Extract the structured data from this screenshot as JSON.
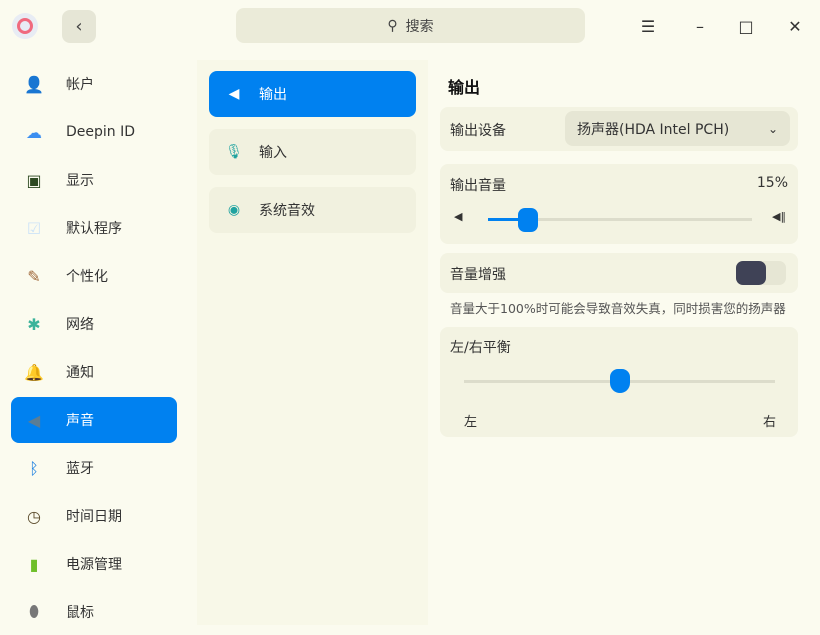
{
  "titlebar": {
    "back_icon": "chevron-left",
    "search_placeholder": "搜索",
    "menu_icon": "☰",
    "min_icon": "–",
    "max_icon": "□",
    "close_icon": "✕"
  },
  "sidebar": {
    "items": [
      {
        "label": "帐户",
        "icon": "user-icon",
        "color": "#222"
      },
      {
        "label": "Deepin ID",
        "icon": "cloud-icon",
        "color": "#3b8ef0"
      },
      {
        "label": "显示",
        "icon": "monitor-icon",
        "color": "#2e4a22"
      },
      {
        "label": "默认程序",
        "icon": "default-apps-icon",
        "color": "#cde3f7"
      },
      {
        "label": "个性化",
        "icon": "palette-icon",
        "color": "#a0683a"
      },
      {
        "label": "网络",
        "icon": "network-icon",
        "color": "#3bb39a"
      },
      {
        "label": "通知",
        "icon": "bell-icon",
        "color": "#8b8a6a"
      },
      {
        "label": "声音",
        "icon": "speaker-icon",
        "color": "#5a7d95"
      },
      {
        "label": "蓝牙",
        "icon": "bluetooth-icon",
        "color": "#1a7fe0"
      },
      {
        "label": "时间日期",
        "icon": "clock-icon",
        "color": "#5a4a2a"
      },
      {
        "label": "电源管理",
        "icon": "battery-icon",
        "color": "#6fbf2a"
      },
      {
        "label": "鼠标",
        "icon": "mouse-icon",
        "color": "#777"
      }
    ]
  },
  "sub": {
    "items": [
      {
        "label": "输出",
        "icon": "speaker-icon"
      },
      {
        "label": "输入",
        "icon": "microphone-icon"
      },
      {
        "label": "系统音效",
        "icon": "sound-effects-icon"
      }
    ]
  },
  "output": {
    "title": "输出",
    "device_label": "输出设备",
    "device_value": "扬声器(HDA Intel PCH)",
    "volume_label": "输出音量",
    "volume_text": "15%",
    "volume_fraction": 0.15,
    "boost_label": "音量增强",
    "boost_on": false,
    "boost_note": "音量大于100%时可能会导致音效失真，同时损害您的扬声器",
    "balance_label": "左/右平衡",
    "balance_left": "左",
    "balance_right": "右",
    "balance_value": 0.5
  },
  "colors": {
    "accent": "#0081f0"
  }
}
